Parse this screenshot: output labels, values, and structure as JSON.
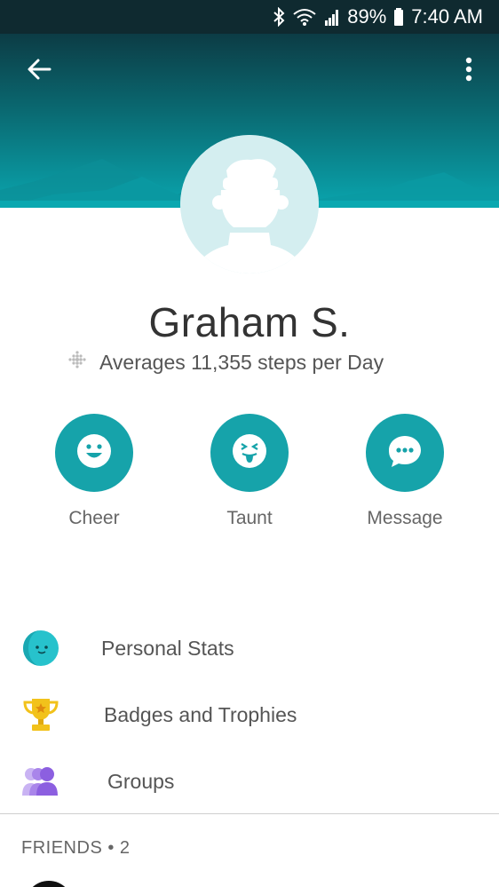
{
  "status_bar": {
    "battery": "89%",
    "time": "7:40 AM",
    "icons": [
      "bluetooth-icon",
      "wifi-icon",
      "signal-icon",
      "battery-icon"
    ]
  },
  "header": {
    "back_icon": "arrow-left-icon",
    "menu_icon": "more-vertical-icon"
  },
  "profile": {
    "name": "Graham S.",
    "steps_text": "Averages 11,355 steps per Day",
    "avatar_icon": "default-avatar-icon"
  },
  "actions": [
    {
      "label": "Cheer",
      "icon": "smile-icon"
    },
    {
      "label": "Taunt",
      "icon": "tongue-face-icon"
    },
    {
      "label": "Message",
      "icon": "chat-bubble-icon"
    }
  ],
  "menu": [
    {
      "label": "Personal Stats",
      "icon": "personal-stats-icon"
    },
    {
      "label": "Badges and Trophies",
      "icon": "trophy-icon"
    },
    {
      "label": "Groups",
      "icon": "groups-icon"
    }
  ],
  "friends": {
    "label": "FRIENDS • 2"
  },
  "colors": {
    "accent": "#16a3aa",
    "header_top": "#0c3c45",
    "header_bottom": "#0aa5ae",
    "avatar_bg": "#d4eef0",
    "trophy": "#f2c21b",
    "groups": "#8c5fe0"
  }
}
